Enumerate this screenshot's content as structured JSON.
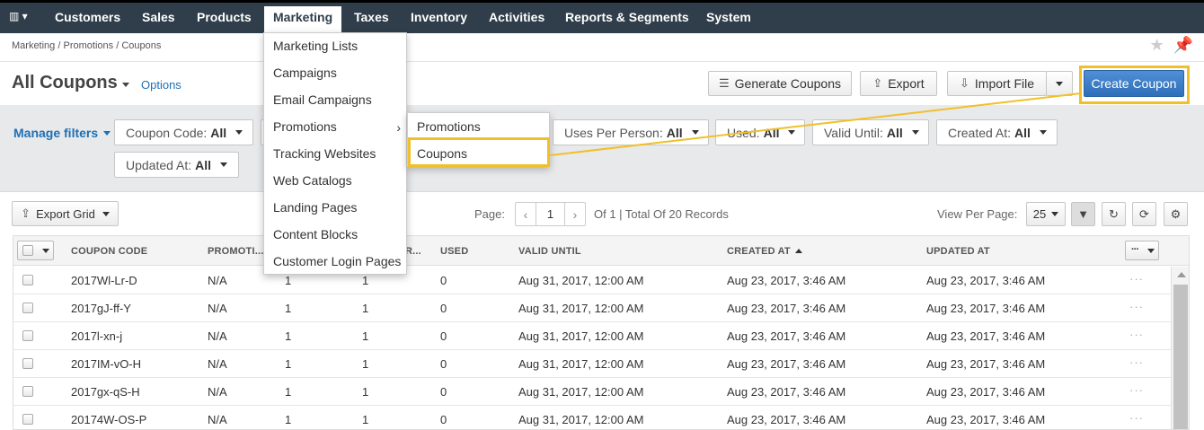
{
  "nav": {
    "logo": " ▾",
    "items": [
      {
        "label": "Customers"
      },
      {
        "label": "Sales"
      },
      {
        "label": "Products"
      },
      {
        "label": "Marketing"
      },
      {
        "label": "Taxes"
      },
      {
        "label": "Inventory"
      },
      {
        "label": "Activities"
      },
      {
        "label": "Reports & Segments"
      },
      {
        "label": "System"
      }
    ],
    "active": "Marketing"
  },
  "breadcrumb": [
    "Marketing",
    "Promotions",
    "Coupons"
  ],
  "breadcrumb_sep": "/",
  "top_icons": [
    "star-icon",
    "pin-icon"
  ],
  "page": {
    "title": "All Coupons",
    "options_label": "Options"
  },
  "actions": {
    "generate_label": "Generate Coupons",
    "export_label": "Export",
    "import_label": "Import File",
    "create_label": "Create Coupon"
  },
  "filters": {
    "manage_label": "Manage filters",
    "items": [
      {
        "label": "Coupon Code:",
        "value": "All"
      },
      {
        "label": "Uses Per Person:",
        "value": "All"
      },
      {
        "label": "Used:",
        "value": "All"
      },
      {
        "label": "Valid Until:",
        "value": "All"
      },
      {
        "label": "Created At:",
        "value": "All"
      },
      {
        "label": "Updated At:",
        "value": "All"
      }
    ]
  },
  "grid_toolbar": {
    "export_grid_label": "Export Grid",
    "page_label": "Page:",
    "page_value": "1",
    "records_text": "Of 1 | Total Of 20 Records",
    "view_per_page_label": "View Per Page:",
    "view_per_page_value": "25"
  },
  "menu": {
    "items": [
      {
        "label": "Marketing Lists"
      },
      {
        "label": "Campaigns"
      },
      {
        "label": "Email Campaigns"
      },
      {
        "label": "Promotions"
      },
      {
        "label": "Tracking Websites"
      },
      {
        "label": "Web Catalogs"
      },
      {
        "label": "Landing Pages"
      },
      {
        "label": "Content Blocks"
      },
      {
        "label": "Customer Login Pages"
      }
    ],
    "submenu": [
      {
        "label": "Promotions"
      },
      {
        "label": "Coupons"
      }
    ]
  },
  "table": {
    "columns": [
      "Coupon Code",
      "Promoti...",
      "R...",
      "Used",
      "Valid Until",
      "Created At",
      "Updated At"
    ],
    "rows": [
      {
        "code": "2017Wl-Lr-D",
        "promotion": "N/A",
        "uses_per_person": "1",
        "uses_per_coupon": "1",
        "used": "0",
        "valid_until": "Aug 31, 2017, 12:00 AM",
        "created_at": "Aug 23, 2017, 3:46 AM",
        "updated_at": "Aug 23, 2017, 3:46 AM"
      },
      {
        "code": "2017gJ-ff-Y",
        "promotion": "N/A",
        "uses_per_person": "1",
        "uses_per_coupon": "1",
        "used": "0",
        "valid_until": "Aug 31, 2017, 12:00 AM",
        "created_at": "Aug 23, 2017, 3:46 AM",
        "updated_at": "Aug 23, 2017, 3:46 AM"
      },
      {
        "code": "2017l-xn-j",
        "promotion": "N/A",
        "uses_per_person": "1",
        "uses_per_coupon": "1",
        "used": "0",
        "valid_until": "Aug 31, 2017, 12:00 AM",
        "created_at": "Aug 23, 2017, 3:46 AM",
        "updated_at": "Aug 23, 2017, 3:46 AM"
      },
      {
        "code": "2017IM-vO-H",
        "promotion": "N/A",
        "uses_per_person": "1",
        "uses_per_coupon": "1",
        "used": "0",
        "valid_until": "Aug 31, 2017, 12:00 AM",
        "created_at": "Aug 23, 2017, 3:46 AM",
        "updated_at": "Aug 23, 2017, 3:46 AM"
      },
      {
        "code": "2017gx-qS-H",
        "promotion": "N/A",
        "uses_per_person": "1",
        "uses_per_coupon": "1",
        "used": "0",
        "valid_until": "Aug 31, 2017, 12:00 AM",
        "created_at": "Aug 23, 2017, 3:46 AM",
        "updated_at": "Aug 23, 2017, 3:46 AM"
      },
      {
        "code": "20174W-OS-P",
        "promotion": "N/A",
        "uses_per_person": "1",
        "uses_per_coupon": "1",
        "used": "0",
        "valid_until": "Aug 31, 2017, 12:00 AM",
        "created_at": "Aug 23, 2017, 3:46 AM",
        "updated_at": "Aug 23, 2017, 3:46 AM"
      }
    ]
  },
  "colors": {
    "nav_bg": "#2f3e4a",
    "accent": "#1f6fb5",
    "primary_button": "#3b7cc9",
    "annotation": "#f0c02a",
    "filter_bg": "#e8e9eb"
  }
}
